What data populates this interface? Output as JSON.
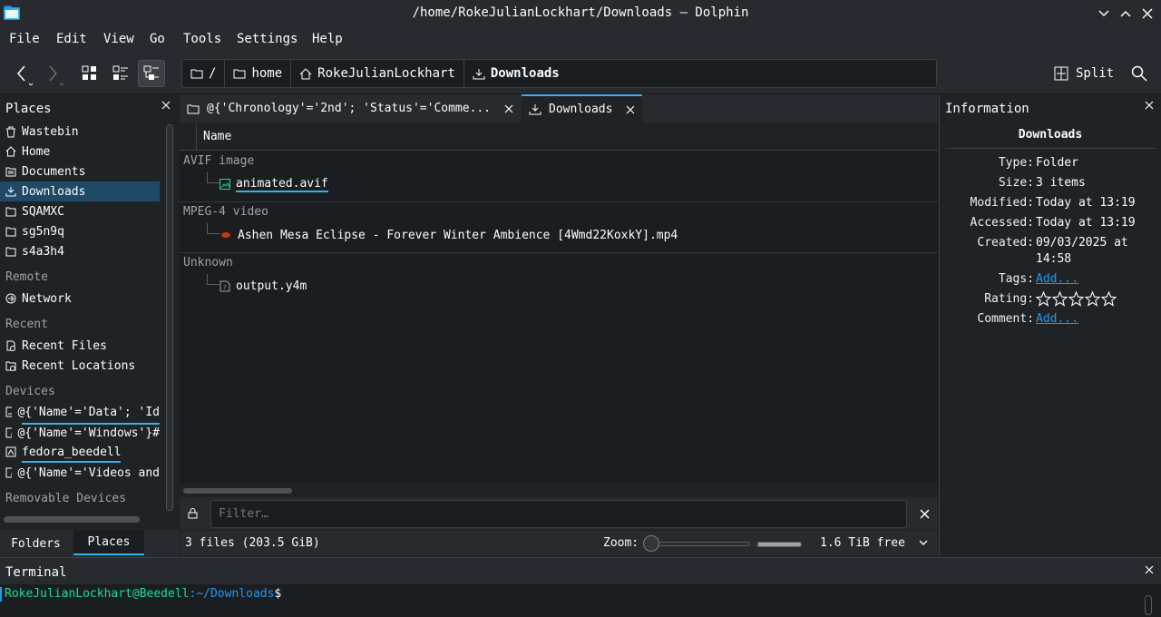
{
  "window": {
    "title": "/home/RokeJulianLockhart/Downloads — Dolphin"
  },
  "menu": [
    "File",
    "Edit",
    "View",
    "Go",
    "Tools",
    "Settings",
    "Help"
  ],
  "breadcrumb": [
    "/",
    "home",
    "RokeJulianLockhart",
    "Downloads"
  ],
  "toolbar": {
    "split_label": "Split"
  },
  "places": {
    "title": "Places",
    "items": [
      "Wastebin",
      "Home",
      "Documents",
      "Downloads",
      "SQAMXC",
      "sg5n9q",
      "s4a3h4"
    ],
    "remote_section": "Remote",
    "remote_items": [
      "Network"
    ],
    "recent_section": "Recent",
    "recent_items": [
      "Recent Files",
      "Recent Locations"
    ],
    "devices_section": "Devices",
    "devices_items": [
      "@{'Name'='Data'; 'Id",
      "@{'Name'='Windows'}#",
      "fedora_beedell",
      "@{'Name'='Videos and"
    ],
    "removable_section": "Removable Devices"
  },
  "tabs": [
    {
      "label": "@{'Chronology'='2nd'; 'Status'='Comme..."
    },
    {
      "label": "Downloads"
    }
  ],
  "columns": {
    "name": "Name"
  },
  "groups": [
    {
      "label": "AVIF image",
      "file": "animated.avif"
    },
    {
      "label": "MPEG-4 video",
      "file": "Ashen Mesa Eclipse - Forever Winter Ambience [4Wmd22KoxkY].mp4"
    },
    {
      "label": "Unknown",
      "file": "output.y4m"
    }
  ],
  "filter": {
    "placeholder": "Filter…"
  },
  "status": {
    "summary": "3 files (203.5 GiB)",
    "zoom_label": "Zoom:",
    "free_space": "1.6 TiB free",
    "zoom_level": 0.0,
    "free_fraction": 0.98
  },
  "info": {
    "title": "Information",
    "heading": "Downloads",
    "type_label": "Type:",
    "type_value": "Folder",
    "size_label": "Size:",
    "size_value": "3 items",
    "modified_label": "Modified:",
    "modified_value": "Today at 13:19",
    "accessed_label": "Accessed:",
    "accessed_value": "Today at 13:19",
    "created_label": "Created:",
    "created_value_1": "09/03/2025 at",
    "created_value_2": "14:58",
    "tags_label": "Tags:",
    "tags_value": "Add...",
    "rating_label": "Rating:",
    "rating_stars": 0,
    "comment_label": "Comment:",
    "comment_value": "Add..."
  },
  "bottom_tabs": [
    "Folders",
    "Places"
  ],
  "terminal": {
    "title": "Terminal",
    "user_host": "RokeJulianLockhart@Beedell",
    "path": ":~/Downloads",
    "prompt": "$"
  },
  "colors": {
    "accent": "#3daee9",
    "selection": "#1e4a68",
    "link": "#1d99f3",
    "terminal_green": "#1cdc9a",
    "terminal_blue": "#1d99f3"
  }
}
